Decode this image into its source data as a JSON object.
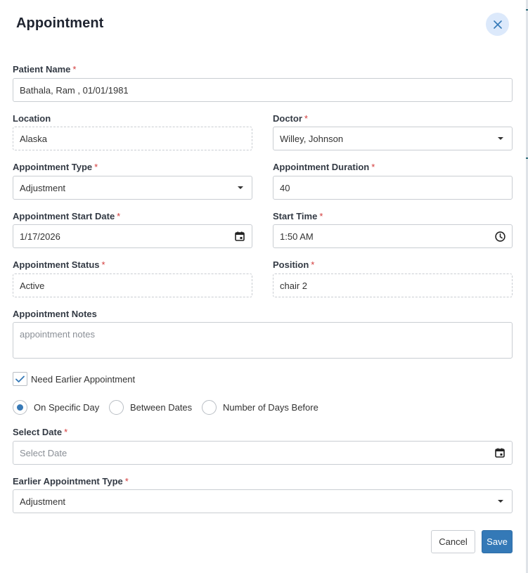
{
  "dialog": {
    "title": "Appointment"
  },
  "fields": {
    "patient_name": {
      "label": "Patient Name",
      "required": "*",
      "value": "Bathala, Ram , 01/01/1981"
    },
    "location": {
      "label": "Location",
      "value": "Alaska"
    },
    "doctor": {
      "label": "Doctor",
      "required": "*",
      "value": "Willey, Johnson"
    },
    "appointment_type": {
      "label": "Appointment Type",
      "required": "*",
      "value": "Adjustment"
    },
    "appointment_duration": {
      "label": "Appointment Duration",
      "required": "*",
      "value": "40"
    },
    "start_date": {
      "label": "Appointment Start Date",
      "required": "*",
      "value": "1/17/2026"
    },
    "start_time": {
      "label": "Start Time",
      "required": "*",
      "value": "1:50 AM"
    },
    "status": {
      "label": "Appointment Status",
      "required": "*",
      "value": "Active"
    },
    "position": {
      "label": "Position",
      "required": "*",
      "value": "chair 2"
    },
    "notes": {
      "label": "Appointment Notes",
      "placeholder": "appointment notes"
    }
  },
  "earlier": {
    "checkbox_label": "Need Earlier Appointment",
    "checked": true,
    "radio_options": [
      "On Specific Day",
      "Between Dates",
      "Number of Days Before"
    ],
    "selected_option": "On Specific Day",
    "select_date": {
      "label": "Select Date",
      "required": "*",
      "placeholder": "Select Date"
    },
    "earlier_type": {
      "label": "Earlier Appointment Type",
      "required": "*",
      "value": "Adjustment"
    }
  },
  "buttons": {
    "cancel": "Cancel",
    "save": "Save"
  },
  "icons": {
    "close": "close-icon",
    "calendar": "calendar-icon",
    "clock": "clock-icon",
    "dropdown": "chevron-down-icon",
    "check": "check-icon"
  },
  "colors": {
    "primary": "#3479b7",
    "required": "#d33b3b",
    "close_bg": "#dce9fb"
  }
}
